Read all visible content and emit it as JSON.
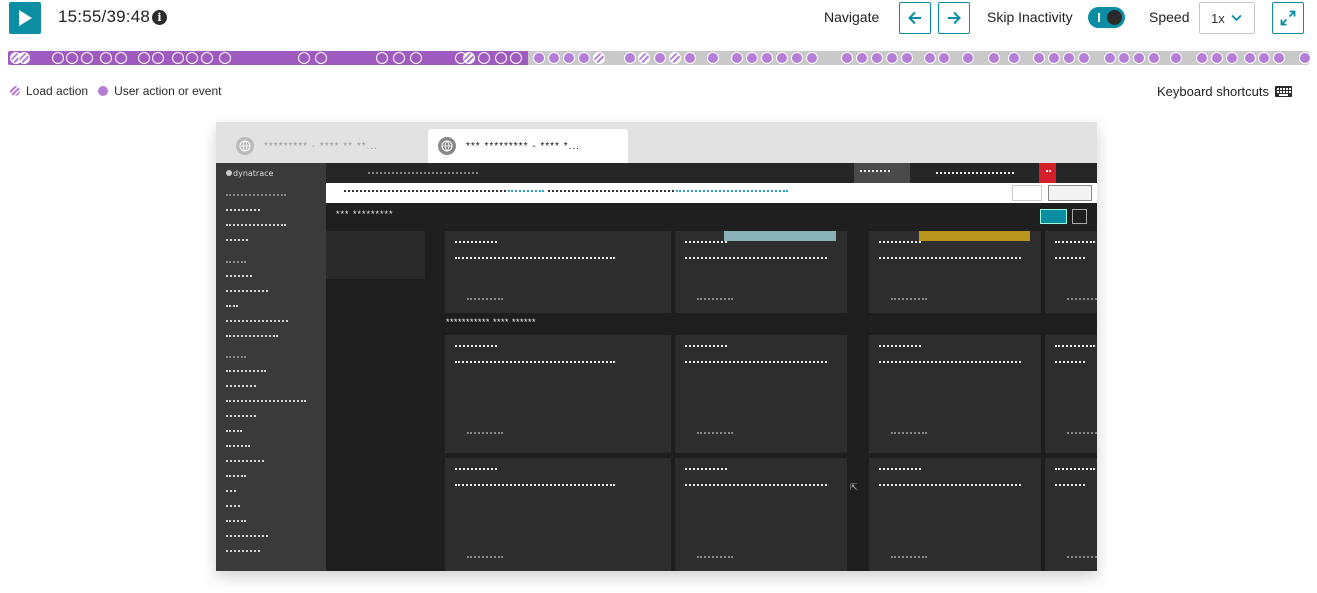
{
  "toolbar": {
    "time_display": "15:55/39:48",
    "navigate_label": "Navigate",
    "skip_inactivity_label": "Skip Inactivity",
    "skip_inactivity_on": true,
    "speed_label": "Speed",
    "speed_value": "1x"
  },
  "timeline": {
    "progress_fraction": 0.4,
    "colors": {
      "played": "#9f5bbf",
      "remaining": "#c9c9c9",
      "marker": "#b57dd6"
    }
  },
  "legend": {
    "load_action": "Load action",
    "user_action": "User action or event"
  },
  "keyboard_shortcuts_label": "Keyboard shortcuts",
  "replay": {
    "tabs": [
      {
        "label": "********* - **** ** **..."
      },
      {
        "label": "*** ********* - **** *..."
      }
    ],
    "brand": "dynatrace",
    "dashboard_title": "*** *********",
    "section_heading": "*********** **** ******"
  },
  "colors": {
    "accent": "#0b8ea3",
    "dark": "#2b2b2b"
  }
}
